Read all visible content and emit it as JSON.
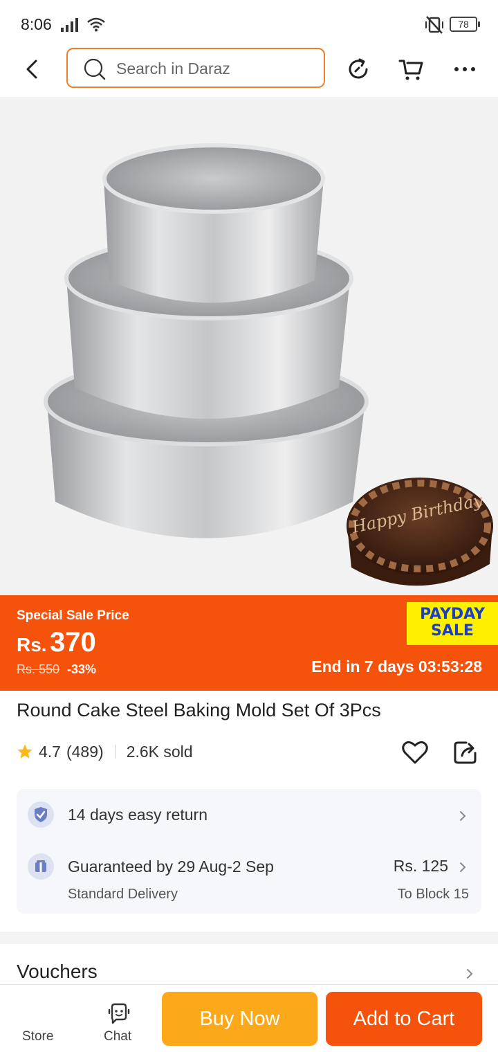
{
  "status_bar": {
    "time": "8:06",
    "battery": "78"
  },
  "search": {
    "placeholder": "Search in Daraz"
  },
  "sale": {
    "label": "Special Sale Price",
    "currency": "Rs.",
    "price": "370",
    "old_price": "Rs. 550",
    "discount": "-33%",
    "badge_line1": "PAYDAY",
    "badge_line2": "SALE",
    "ends": "End in 7 days 03:53:28"
  },
  "product": {
    "title": "Round Cake Steel Baking Mold Set Of 3Pcs",
    "rating": "4.7",
    "reviews": "(489)",
    "sold": "2.6K sold",
    "image_text": "Happy Birthday"
  },
  "services": {
    "return_text": "14 days easy return",
    "delivery_text": "Guaranteed by 29 Aug-2 Sep",
    "delivery_sub": "Standard Delivery",
    "delivery_price": "Rs. 125",
    "delivery_to": "To Block 15"
  },
  "vouchers": {
    "title": "Vouchers"
  },
  "bottom": {
    "store": "Store",
    "chat": "Chat",
    "buy_now": "Buy Now",
    "add_to_cart": "Add to Cart"
  },
  "colors": {
    "brand_orange": "#f5520c",
    "buy_yellow": "#fba91a",
    "payday_yellow": "#fff000",
    "payday_blue": "#1c3fc0"
  }
}
